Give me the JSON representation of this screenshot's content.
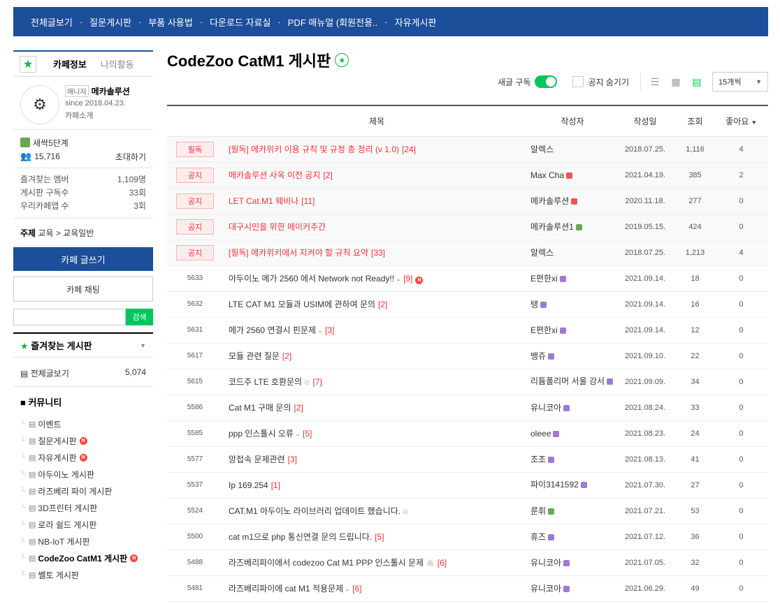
{
  "topnav": [
    "전체글보기",
    "질문게시판",
    "부품 사용법",
    "다운로드 자료실",
    "PDF 매뉴얼 (회원전용..",
    "자유게시판"
  ],
  "sidebar": {
    "tab_info": "카페정보",
    "tab_activity": "나의활동",
    "manager_tag": "매니저",
    "manager_name": "메카솔루션",
    "since": "since 2018.04.23.",
    "intro": "카페소개",
    "level": "새싹5단계",
    "members": "15,716",
    "invite": "초대하기",
    "fav_members_label": "즐겨찾는 멤버",
    "fav_members_value": "1,109명",
    "board_subs_label": "게시판 구독수",
    "board_subs_value": "33회",
    "app_label": "우리카페앱 수",
    "app_value": "3회",
    "topic_label": "주제",
    "topic_value": "교육 > 교육일반",
    "write_btn": "카페 글쓰기",
    "chat_btn": "카페 채팅",
    "search_btn": "검색",
    "fav_boards": "즐겨찾는 게시판",
    "all_posts": "전체글보기",
    "all_posts_count": "5,074",
    "community": "커뮤니티",
    "boards": [
      {
        "label": "이벤트",
        "new": false
      },
      {
        "label": "질문게시판",
        "new": true
      },
      {
        "label": "자유게시판",
        "new": true
      },
      {
        "label": "아두이노 게시판",
        "new": false
      },
      {
        "label": "라즈베리 파이 게시판",
        "new": false
      },
      {
        "label": "3D프린터 게시판",
        "new": false
      },
      {
        "label": "로라 쉴드 게시판",
        "new": false
      },
      {
        "label": "NB-IoT 게시판",
        "new": false
      },
      {
        "label": "CodeZoo CatM1 게시판",
        "new": true,
        "active": true
      },
      {
        "label": "쎌토 게시판",
        "new": false
      }
    ]
  },
  "main": {
    "title": "CodeZoo CatM1 게시판",
    "subscribe": "새글 구독",
    "hide_notice": "공지 숨기기",
    "per_page": "15개씩",
    "columns": [
      "제목",
      "작성자",
      "작성일",
      "조회",
      "좋아요"
    ],
    "notices": [
      {
        "badge": "필독",
        "title": "[필독] 메카위키 이용 규칙 및 규정 총 정리 (v 1.0)",
        "cmt": "[24]",
        "author": "알렉스",
        "lvl": "",
        "date": "2018.07.25.",
        "views": "1,116",
        "likes": "4"
      },
      {
        "badge": "공지",
        "title": "메카솔루션 사옥 이전 공지",
        "cmt": "[2]",
        "author": "Max Cha",
        "lvl": "red",
        "date": "2021.04.19.",
        "views": "385",
        "likes": "2"
      },
      {
        "badge": "공지",
        "title": "LET Cat.M1 웨비나",
        "cmt": "[11]",
        "author": "메카솔루션",
        "lvl": "red",
        "date": "2020.11.18.",
        "views": "277",
        "likes": "0"
      },
      {
        "badge": "공지",
        "title": "대구시민을 위한 메이커주간",
        "cmt": "",
        "author": "메카솔루션1",
        "lvl": "green",
        "date": "2019.05.15.",
        "views": "424",
        "likes": "0"
      },
      {
        "badge": "공지",
        "title": "[필독] 메카위키에서 지켜야 할 규칙 요약",
        "cmt": "[33]",
        "author": "알렉스",
        "lvl": "",
        "date": "2018.07.25.",
        "views": "1,213",
        "likes": "4"
      }
    ],
    "posts": [
      {
        "num": "5633",
        "title": "아두이노 메가 2560 에서 Network not Ready!!",
        "cmt": "[9]",
        "icon": "◒",
        "new": true,
        "author": "E편한xi",
        "lvl": "purple",
        "date": "2021.09.14.",
        "views": "18",
        "likes": "0"
      },
      {
        "num": "5632",
        "title": "LTE CAT M1 모듈과 USIM에 관하여 문의",
        "cmt": "[2]",
        "icon": "",
        "new": false,
        "author": "탱",
        "lvl": "purple",
        "date": "2021.09.14.",
        "views": "16",
        "likes": "0"
      },
      {
        "num": "5631",
        "title": "메가 2560 연결시 핀문제",
        "cmt": "[3]",
        "icon": "◒",
        "new": false,
        "author": "E편한xi",
        "lvl": "purple",
        "date": "2021.09.14.",
        "views": "12",
        "likes": "0"
      },
      {
        "num": "5617",
        "title": "모듈 관련 질문",
        "cmt": "[2]",
        "icon": "",
        "new": false,
        "author": "뱅쥬",
        "lvl": "purple",
        "date": "2021.09.10.",
        "views": "22",
        "likes": "0"
      },
      {
        "num": "5615",
        "title": "코드주 LTE 호환문의",
        "cmt": "[7]",
        "icon": "⊘",
        "new": false,
        "author": "리튬폴리머 서울 강서",
        "lvl": "purple",
        "date": "2021.09.09.",
        "views": "34",
        "likes": "0"
      },
      {
        "num": "5586",
        "title": "Cat M1 구매 문의",
        "cmt": "[2]",
        "icon": "",
        "new": false,
        "author": "유니코아",
        "lvl": "purple",
        "date": "2021.08.24.",
        "views": "33",
        "likes": "0"
      },
      {
        "num": "5585",
        "title": "ppp 인스톨시 오류",
        "cmt": "[5]",
        "icon": "◒",
        "new": false,
        "author": "oleee",
        "lvl": "purple",
        "date": "2021.08.23.",
        "views": "24",
        "likes": "0"
      },
      {
        "num": "5577",
        "title": "망접속 문제관련",
        "cmt": "[3]",
        "icon": "",
        "new": false,
        "author": "조조",
        "lvl": "purple",
        "date": "2021.08.13.",
        "views": "41",
        "likes": "0"
      },
      {
        "num": "5537",
        "title": "Ip 169.254",
        "cmt": "[1]",
        "icon": "",
        "new": false,
        "author": "파이3141592",
        "lvl": "purple",
        "date": "2021.07.30.",
        "views": "27",
        "likes": "0"
      },
      {
        "num": "5524",
        "title": "CAT.M1 아두이노 라이브러리 업데이트 했습니다.",
        "cmt": "",
        "icon": "⊘",
        "new": false,
        "author": "룬휘",
        "lvl": "green",
        "date": "2021.07.21.",
        "views": "53",
        "likes": "0"
      },
      {
        "num": "5500",
        "title": "cat m1으로 php 통신연결 문의 드립니다.",
        "cmt": "[5]",
        "icon": "",
        "new": false,
        "author": "휴즈",
        "lvl": "purple",
        "date": "2021.07.12.",
        "views": "36",
        "likes": "0"
      },
      {
        "num": "5488",
        "title": "라즈베리파이에서 codezoo Cat M1 PPP 인스톨시 문제",
        "cmt": "[6]",
        "icon": "🖇",
        "new": false,
        "author": "유니코아",
        "lvl": "purple",
        "date": "2021.07.05.",
        "views": "32",
        "likes": "0"
      },
      {
        "num": "5481",
        "title": "라즈베리파이에 cat M1 적용문제",
        "cmt": "[6]",
        "icon": "◒",
        "new": false,
        "author": "유니코아",
        "lvl": "purple",
        "date": "2021.06.29.",
        "views": "49",
        "likes": "0"
      }
    ]
  }
}
